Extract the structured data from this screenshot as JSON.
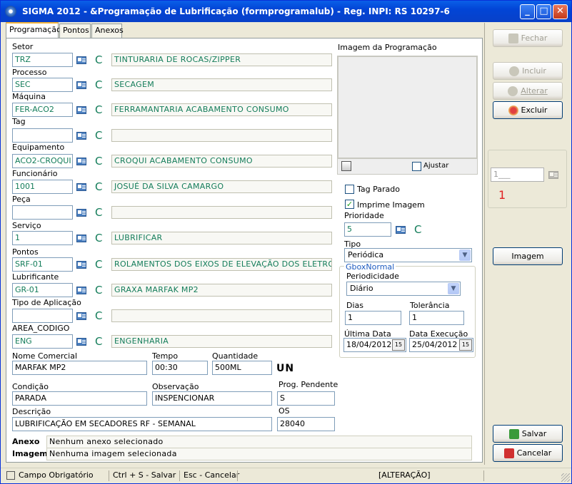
{
  "window": {
    "title": "SIGMA 2012 - &Programação de Lubrificação  (formprogramalub)  - Reg. INPI: RS 10297-6"
  },
  "tabs": [
    {
      "label": "Programação"
    },
    {
      "label": "Pontos"
    },
    {
      "label": "Anexos"
    }
  ],
  "fields": {
    "setor": {
      "label": "Setor",
      "code": "TRZ",
      "desc": "TINTURARIA DE ROCAS/ZIPPER"
    },
    "processo": {
      "label": "Processo",
      "code": "SEC",
      "desc": "SECAGEM"
    },
    "maquina": {
      "label": "Máquina",
      "code": "FER-ACO2",
      "desc": "FERRAMANTARIA ACABAMENTO CONSUMO"
    },
    "tag": {
      "label": "Tag",
      "code": "",
      "desc": ""
    },
    "equipamento": {
      "label": "Equipamento",
      "code": "ACO2-CROQUI",
      "desc": "CROQUI ACABAMENTO CONSUMO"
    },
    "funcionario": {
      "label": "Funcionário",
      "code": "1001",
      "desc": " JOSUÉ DA SILVA CAMARGO"
    },
    "peca": {
      "label": "Peça",
      "code": "",
      "desc": ""
    },
    "servico": {
      "label": "Serviço",
      "code": "1",
      "desc": "LUBRIFICAR"
    },
    "pontos": {
      "label": "Pontos",
      "code": "SRF-01",
      "desc": "ROLAMENTOS DOS EIXOS DE ELEVAÇÃO DOS ELETRODOS"
    },
    "lubrificante": {
      "label": "Lubrificante",
      "code": "GR-01",
      "desc": "GRAXA MARFAK MP2"
    },
    "tipo_aplicacao": {
      "label": "Tipo de Aplicação",
      "code": "",
      "desc": ""
    },
    "area_codigo": {
      "label": "AREA_CODIGO",
      "code": "ENG",
      "desc": "ENGENHARIA"
    }
  },
  "lookup_letter": "C",
  "bottom": {
    "nome_comercial_label": "Nome Comercial",
    "nome_comercial": "MARFAK MP2",
    "tempo_label": "Tempo",
    "tempo": "00:30",
    "quantidade_label": "Quantidade",
    "quantidade": "500ML",
    "unidade": "UN",
    "condicao_label": "Condição",
    "condicao": "PARADA",
    "observacao_label": "Observação",
    "observacao": "INSPENCIONAR",
    "prog_pendente_label": "Prog. Pendente",
    "prog_pendente": "S",
    "descricao_label": "Descrição",
    "descricao": "LUBRIFICAÇÃO EM SECADORES RF - SEMANAL",
    "os_label": "OS",
    "os": "28040",
    "anexo_label": "Anexo",
    "anexo": "Nenhum anexo selecionado",
    "imagem_label": "Imagem",
    "imagem": "Nenhuma imagem selecionada"
  },
  "right_panel": {
    "imagem_title": "Imagem da Programação",
    "ajustar": "Ajustar",
    "tag_parado": "Tag Parado",
    "imprime_imagem": "Imprime Imagem",
    "prioridade_label": "Prioridade",
    "prioridade": "5",
    "tipo_label": "Tipo",
    "tipo": "Periódica",
    "group_title": "GboxNormal",
    "periodicidade_label": "Periodicidade",
    "periodicidade": "Diário",
    "dias_label": "Dias",
    "dias": "1",
    "tolerancia_label": "Tolerância",
    "tolerancia": "1",
    "ultima_data_label": "Última Data",
    "ultima_data": "18/04/2012",
    "data_execucao_label": "Data Execução",
    "data_execucao": "25/04/2012"
  },
  "side": {
    "fechar": "Fechar",
    "incluir": "Incluir",
    "alterar": "Alterar",
    "excluir": "Excluir",
    "record_field": "1___",
    "record_number": "1",
    "imagem": "Imagem",
    "salvar": "Salvar",
    "cancelar": "Cancelar"
  },
  "status": {
    "campo_obrigatorio": "Campo Obrigatório",
    "salvar_hint": "Ctrl + S - Salvar",
    "cancelar_hint": "Esc - Cancelar",
    "mode": "[ALTERAÇÃO]"
  },
  "colors": {
    "accent_green": "#147D5A",
    "record_red": "#E02020",
    "title_blue": "#0A5FE8"
  }
}
